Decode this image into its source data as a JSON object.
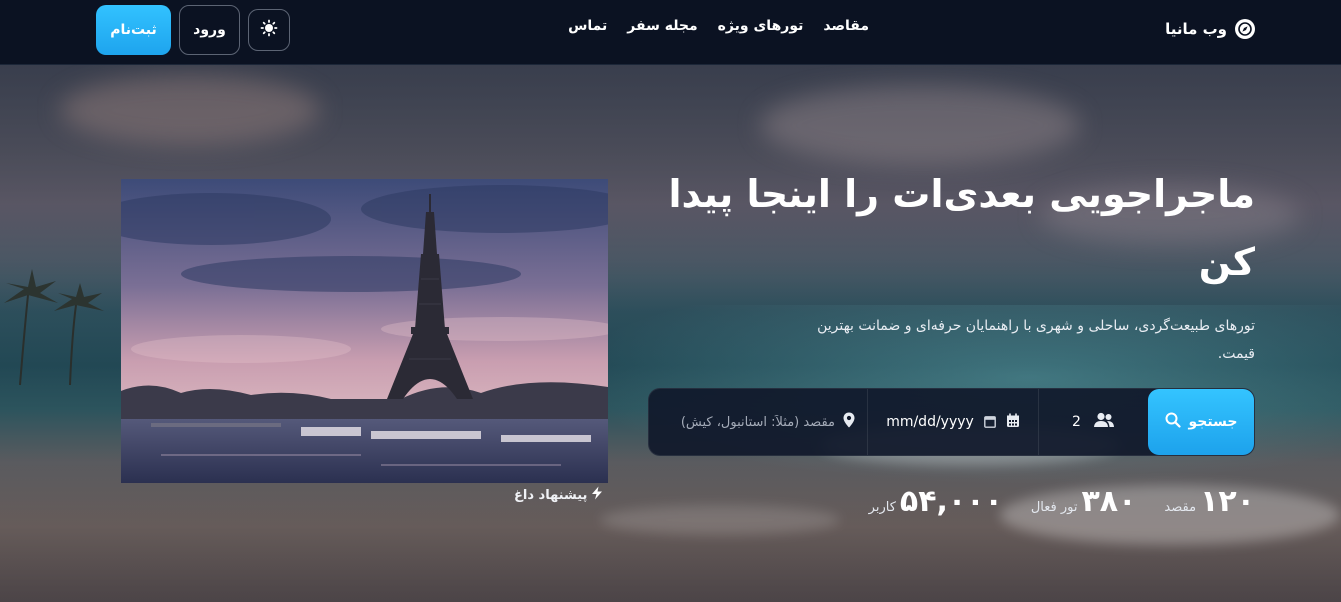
{
  "brand": {
    "name": "وب مانیا",
    "icon": "compass-icon"
  },
  "nav": {
    "links": [
      {
        "label": "مقاصد"
      },
      {
        "label": "تورهای ویژه"
      },
      {
        "label": "مجله سفر"
      },
      {
        "label": "تماس"
      }
    ]
  },
  "header_actions": {
    "theme_icon": "sun-icon",
    "login_label": "ورود",
    "signup_label": "ثبت‌نام"
  },
  "hero": {
    "title": "ماجراجویی بعدی‌ات را اینجا پیدا کن",
    "subtitle": "تورهای طبیعت‌گردی، ساحلی و شهری با راهنمایان حرفه‌ای و ضمانت بهترین قیمت."
  },
  "search": {
    "destination_placeholder": "مقصد (مثلاً: استانبول، کیش)",
    "destination_value": "",
    "date_value": "mm/dd/yyyy",
    "people_value": "2",
    "button_label": "جستجو",
    "icons": [
      "location-pin-icon",
      "calendar-icon",
      "users-icon",
      "search-icon"
    ]
  },
  "stats": [
    {
      "num": "۱۲۰",
      "label": "مقصد"
    },
    {
      "num": "۳۸۰",
      "label": "تور فعال"
    },
    {
      "num": "۵۴,۰۰۰",
      "label": "کاربر"
    }
  ],
  "featured": {
    "caption": "پیشنهاد داغ",
    "caption_icon": "lightning-icon",
    "image_subject": "eiffel-tower-at-dusk"
  },
  "colors": {
    "navbar": "#0b1222",
    "accent": "#1ea4ee",
    "search_bg": "#10182a"
  }
}
